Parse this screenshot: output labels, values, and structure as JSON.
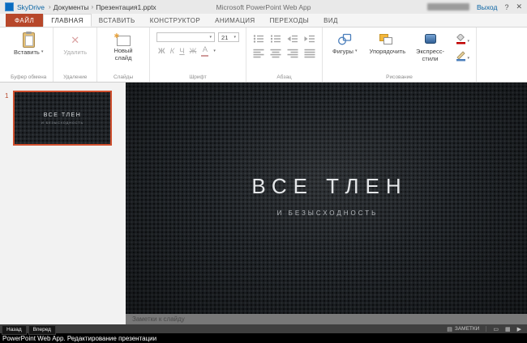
{
  "topbar": {
    "brand": "SkyDrive",
    "crumbs": [
      "Документы",
      "Презентация1.pptx"
    ],
    "app_title": "Microsoft PowerPoint Web App",
    "signout": "Выход"
  },
  "icons": {
    "dropdown": "▾",
    "crumb_sep": "›",
    "help": "?",
    "close": "✕",
    "delete_x": "✕",
    "new_slide_star": "✱",
    "notes": "▤",
    "view_normal": "▭",
    "view_grid": "▦",
    "play": "▶"
  },
  "ribbon": {
    "file_tab": "ФАЙЛ",
    "tabs": [
      {
        "label": "ГЛАВНАЯ",
        "active": true
      },
      {
        "label": "ВСТАВИТЬ"
      },
      {
        "label": "КОНСТРУКТОР"
      },
      {
        "label": "АНИМАЦИЯ"
      },
      {
        "label": "ПЕРЕХОДЫ"
      },
      {
        "label": "ВИД"
      }
    ],
    "groups": {
      "clipboard": {
        "label": "Буфер обмена",
        "paste": "Вставить"
      },
      "deletion": {
        "label": "Удаление",
        "delete": "Удалить"
      },
      "slides": {
        "label": "Слайды",
        "new_slide": "Новый слайд"
      },
      "font": {
        "label": "Шрифт",
        "name": "",
        "size": "21",
        "bold": "Ж",
        "italic": "К",
        "underline": "Ч",
        "color": "А"
      },
      "paragraph": {
        "label": "Абзац"
      },
      "drawing": {
        "label": "Рисование",
        "shapes": "Фигуры",
        "arrange": "Упорядочить",
        "quick_styles": "Экспресс-стили"
      }
    }
  },
  "thumbnails": {
    "number": "1"
  },
  "slide": {
    "title": "ВСЕ ТЛЕН",
    "subtitle": "И БЕЗЫСХОДНОСТЬ"
  },
  "notes": {
    "placeholder": "Заметки к слайду"
  },
  "statusbar": {
    "notes_label": "ЗАМЕТКИ"
  },
  "overlay": {
    "back": "Назад",
    "forward": "Вперед",
    "caption": "PowerPoint Web App. Редактирование презентации"
  },
  "colors": {
    "accent": "#b7472a",
    "link": "#0a64a4"
  }
}
